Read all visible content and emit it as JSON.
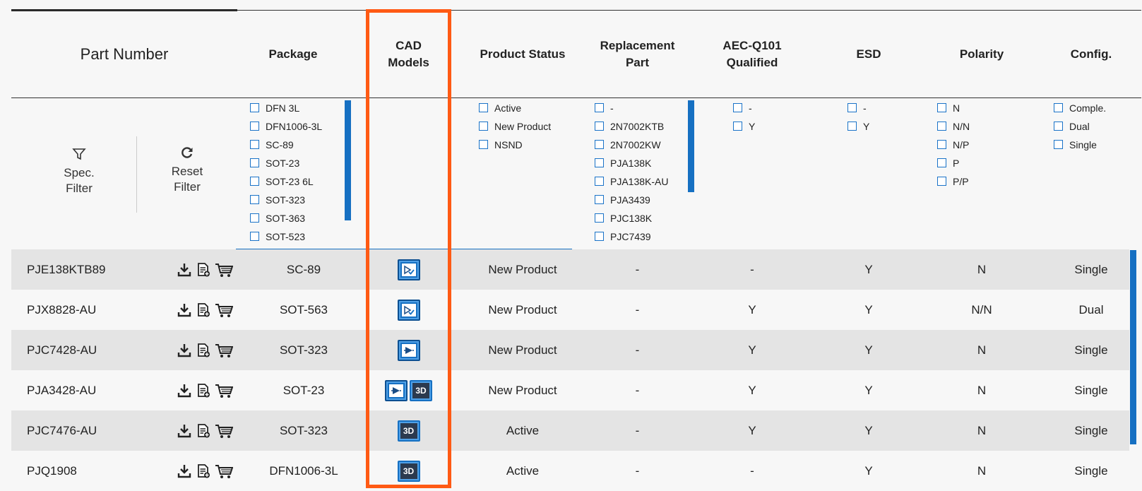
{
  "columns": {
    "part_number": "Part Number",
    "package": "Package",
    "cad_models_line1": "CAD",
    "cad_models_line2": "Models",
    "product_status": "Product Status",
    "replacement_line1": "Replacement",
    "replacement_line2": "Part",
    "aec_line1": "AEC-Q101",
    "aec_line2": "Qualified",
    "esd": "ESD",
    "polarity": "Polarity",
    "config": "Config."
  },
  "tools": {
    "spec_filter_line1": "Spec.",
    "spec_filter_line2": "Filter",
    "reset_filter_line1": "Reset",
    "reset_filter_line2": "Filter"
  },
  "filters": {
    "package": [
      "DFN 3L",
      "DFN1006-3L",
      "SC-89",
      "SOT-23",
      "SOT-23 6L",
      "SOT-323",
      "SOT-363",
      "SOT-523"
    ],
    "product_status": [
      "Active",
      "New Product",
      "NSND"
    ],
    "replacement": [
      "-",
      "2N7002KTB",
      "2N7002KW",
      "PJA138K",
      "PJA138K-AU",
      "PJA3439",
      "PJC138K",
      "PJC7439"
    ],
    "aec": [
      "-",
      "Y"
    ],
    "esd": [
      "-",
      "Y"
    ],
    "polarity": [
      "N",
      "N/N",
      "N/P",
      "P",
      "P/P"
    ],
    "config": [
      "Comple.",
      "Dual",
      "Single"
    ]
  },
  "rows": [
    {
      "part": "PJE138KTB89",
      "package": "SC-89",
      "cad": [
        "schematic-check"
      ],
      "status": "New Product",
      "replacement": "-",
      "aec": "-",
      "esd": "Y",
      "polarity": "N",
      "config": "Single"
    },
    {
      "part": "PJX8828-AU",
      "package": "SOT-563",
      "cad": [
        "schematic-check"
      ],
      "status": "New Product",
      "replacement": "-",
      "aec": "Y",
      "esd": "Y",
      "polarity": "N/N",
      "config": "Dual"
    },
    {
      "part": "PJC7428-AU",
      "package": "SOT-323",
      "cad": [
        "symbol"
      ],
      "status": "New Product",
      "replacement": "-",
      "aec": "Y",
      "esd": "Y",
      "polarity": "N",
      "config": "Single"
    },
    {
      "part": "PJA3428-AU",
      "package": "SOT-23",
      "cad": [
        "symbol",
        "3d"
      ],
      "status": "New Product",
      "replacement": "-",
      "aec": "Y",
      "esd": "Y",
      "polarity": "N",
      "config": "Single"
    },
    {
      "part": "PJC7476-AU",
      "package": "SOT-323",
      "cad": [
        "3d"
      ],
      "status": "Active",
      "replacement": "-",
      "aec": "Y",
      "esd": "Y",
      "polarity": "N",
      "config": "Single"
    },
    {
      "part": "PJQ1908",
      "package": "DFN1006-3L",
      "cad": [
        "3d"
      ],
      "status": "Active",
      "replacement": "-",
      "aec": "-",
      "esd": "Y",
      "polarity": "N",
      "config": "Single"
    }
  ],
  "cad_3d_label": "3D",
  "colors": {
    "accent": "#1670c2",
    "highlight": "#ff5a14"
  }
}
